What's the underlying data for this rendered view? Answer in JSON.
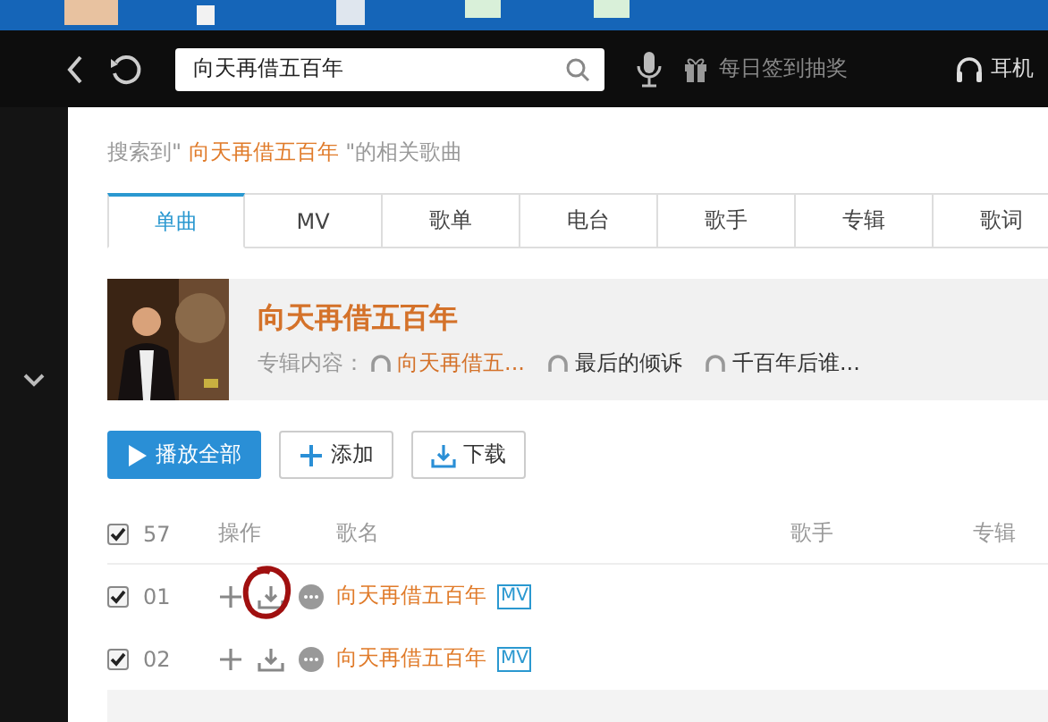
{
  "header": {
    "search": {
      "value": "向天再借五百年"
    },
    "checkin": "每日签到抽奖",
    "headphones": "耳机"
  },
  "summary": {
    "prefix": "搜索到\"",
    "query": "向天再借五百年",
    "suffix": "\"的相关歌曲"
  },
  "tabs": [
    {
      "label": "单曲",
      "selected": true
    },
    {
      "label": "MV",
      "selected": false
    },
    {
      "label": "歌单",
      "selected": false
    },
    {
      "label": "电台",
      "selected": false
    },
    {
      "label": "歌手",
      "selected": false
    },
    {
      "label": "专辑",
      "selected": false
    },
    {
      "label": "歌词",
      "selected": false
    }
  ],
  "album": {
    "title": "向天再借五百年",
    "label": "专辑内容：",
    "tracks": [
      {
        "title": "向天再借五...",
        "selected": true
      },
      {
        "title": "最后的倾诉",
        "selected": false
      },
      {
        "title": "千百年后谁...",
        "selected": false
      }
    ]
  },
  "buttons": [
    {
      "kind": "play",
      "label": "播放全部"
    },
    {
      "kind": "add",
      "label": "添加"
    },
    {
      "kind": "download",
      "label": "下载"
    }
  ],
  "table": {
    "count": "57",
    "all_checked": true,
    "columns": [
      "操作",
      "歌名",
      "歌手",
      "专辑"
    ],
    "rows": [
      {
        "index": "01",
        "checked": true,
        "title": "向天再借五百年",
        "mv": "MV",
        "circled": true
      },
      {
        "index": "02",
        "checked": true,
        "title": "向天再借五百年",
        "mv": "MV",
        "circled": false
      }
    ]
  }
}
